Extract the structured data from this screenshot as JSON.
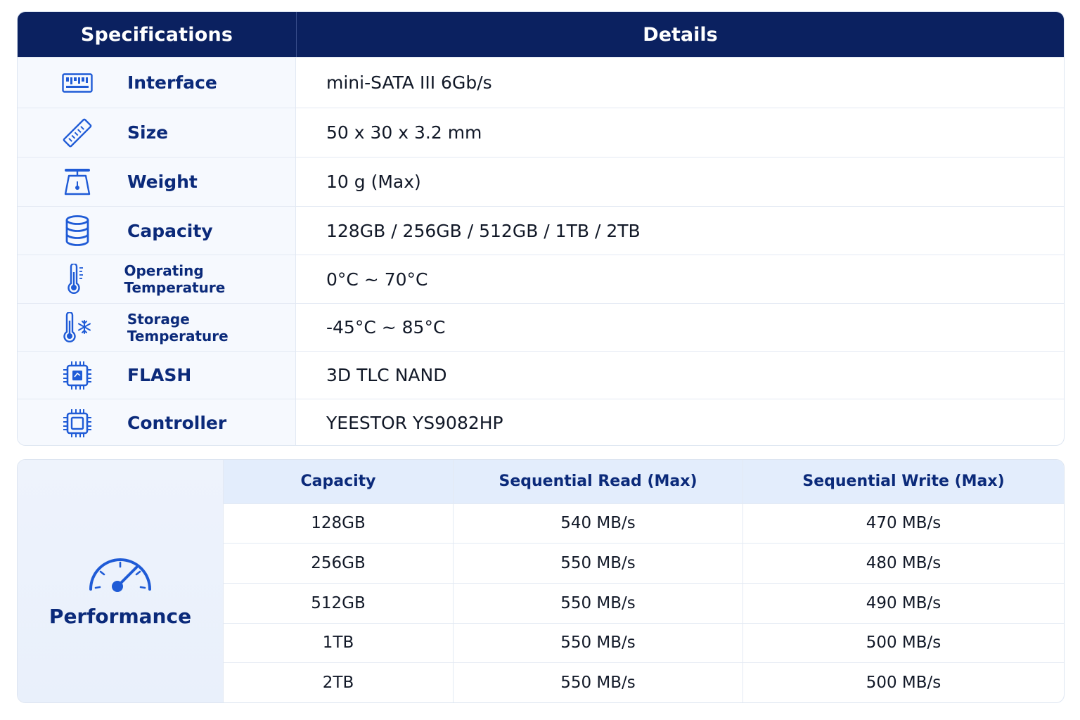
{
  "spec_table": {
    "headers": [
      "Specifications",
      "Details"
    ],
    "rows": [
      {
        "icon": "interface-board-icon",
        "label": "Interface",
        "value": "mini-SATA III 6Gb/s"
      },
      {
        "icon": "ssd-stick-icon",
        "label": "Size",
        "value": "50 x 30 x 3.2 mm"
      },
      {
        "icon": "scale-icon",
        "label": "Weight",
        "value": "10 g (Max)"
      },
      {
        "icon": "database-icon",
        "label": "Capacity",
        "value": "128GB / 256GB / 512GB / 1TB / 2TB"
      },
      {
        "icon": "thermometer-icon",
        "label": "Operating Temperature",
        "value": "0°C ~ 70°C"
      },
      {
        "icon": "thermometer-snowflake-icon",
        "label": "Storage Temperature",
        "value": "-45°C ~ 85°C"
      },
      {
        "icon": "flash-chip-icon",
        "label": "FLASH",
        "value": "3D TLC NAND"
      },
      {
        "icon": "controller-chip-icon",
        "label": "Controller",
        "value": "YEESTOR YS9082HP"
      }
    ]
  },
  "performance": {
    "title": "Performance",
    "icon": "speedometer-icon",
    "headers": [
      "Capacity",
      "Sequential Read (Max)",
      "Sequential Write (Max)"
    ],
    "rows": [
      [
        "128GB",
        "540 MB/s",
        "470 MB/s"
      ],
      [
        "256GB",
        "550 MB/s",
        "480 MB/s"
      ],
      [
        "512GB",
        "550 MB/s",
        "490 MB/s"
      ],
      [
        "1TB",
        "550 MB/s",
        "500 MB/s"
      ],
      [
        "2TB",
        "550 MB/s",
        "500 MB/s"
      ]
    ]
  },
  "colors": {
    "header_bg": "#0b2160",
    "accent_text": "#0b2a7a",
    "icon_blue": "#1f5bd6",
    "perf_header_bg": "#e3edfc"
  }
}
